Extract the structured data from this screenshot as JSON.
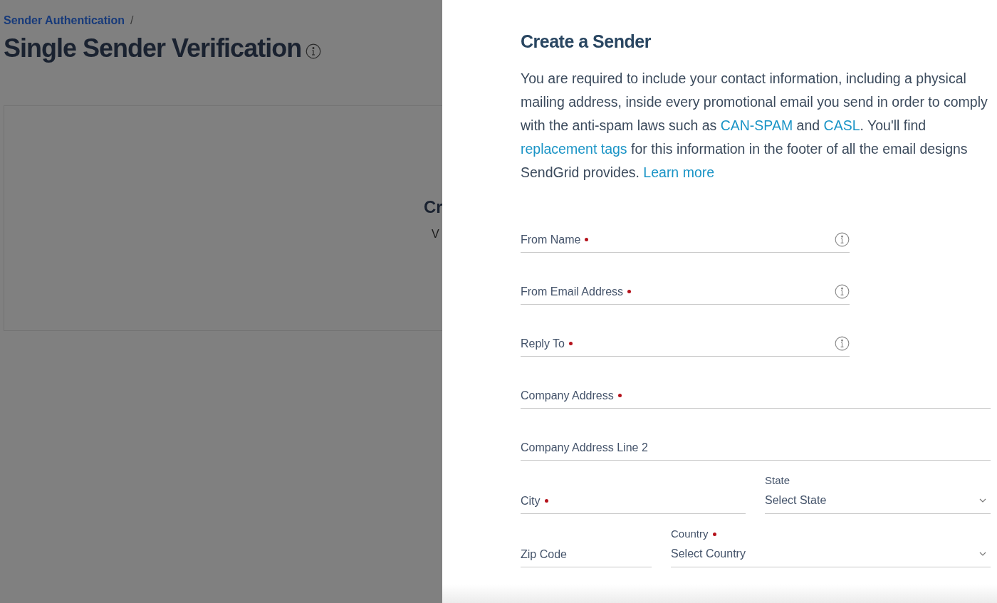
{
  "background": {
    "breadcrumb": {
      "link": "Sender Authentication",
      "separator": "/"
    },
    "title": "Single Sender Verification",
    "card": {
      "heading": "Cr",
      "text": "V"
    }
  },
  "panel": {
    "title": "Create a Sender",
    "intro": [
      {
        "kind": "text",
        "text": "You are required to include your contact information, including a physical mailing address, inside every promotional email you send in order to comply with the anti-spam laws such as "
      },
      {
        "kind": "link",
        "text": "CAN-SPAM"
      },
      {
        "kind": "text",
        "text": " and "
      },
      {
        "kind": "link",
        "text": "CASL"
      },
      {
        "kind": "text",
        "text": ". You'll find "
      },
      {
        "kind": "link",
        "text": "replacement tags"
      },
      {
        "kind": "text",
        "text": " for this information in the footer of all the email designs SendGrid provides. "
      },
      {
        "kind": "link",
        "text": "Learn more"
      }
    ],
    "rows": [
      [
        {
          "kind": "input",
          "label": "From Name",
          "required": true,
          "info": true
        }
      ],
      [
        {
          "kind": "input",
          "label": "From Email Address",
          "required": true,
          "info": true
        }
      ],
      [
        {
          "kind": "input",
          "label": "Reply To",
          "required": true,
          "info": true
        }
      ],
      [
        {
          "kind": "input",
          "label": "Company Address",
          "required": true,
          "info": false
        }
      ],
      [
        {
          "kind": "input",
          "label": "Company Address Line 2",
          "required": false,
          "info": false
        }
      ],
      [
        {
          "kind": "input",
          "label": "City",
          "required": true,
          "info": false
        },
        {
          "kind": "select",
          "label": "State",
          "placeholder": "Select State",
          "required": false,
          "info": false
        }
      ],
      [
        {
          "kind": "input",
          "label": "Zip Code",
          "required": false,
          "info": false
        },
        {
          "kind": "select",
          "label": "Country",
          "placeholder": "Select Country",
          "required": true,
          "info": false
        }
      ]
    ]
  }
}
